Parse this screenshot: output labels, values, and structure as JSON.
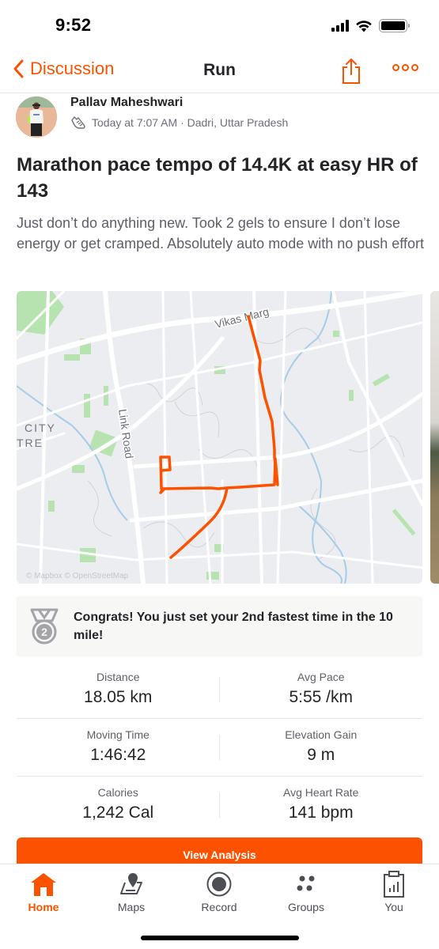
{
  "status_bar": {
    "time": "9:52"
  },
  "nav": {
    "back_label": "Discussion",
    "title": "Run",
    "share_icon": "share-icon",
    "more_icon": "more-horizontal-icon"
  },
  "athlete": {
    "name": "Pallav Maheshwari",
    "activity_icon": "run-shoe-icon",
    "meta": "Today at 7:07 AM · Dadri, Uttar Pradesh"
  },
  "activity": {
    "title": "Marathon pace tempo of 14.4K at easy HR of 143",
    "description": "Just don’t do anything new. Took 2 gels to ensure I don’t lose energy or get cramped. Absolutely auto mode with no push effort"
  },
  "map": {
    "labels": {
      "road_top": "Vikas Marg",
      "road_left": "Link Road",
      "area_line1": "CITY",
      "area_line2": "TRE"
    },
    "route_color": "#fc5200",
    "attribution": "© Mapbox © OpenStreetMap"
  },
  "achievement": {
    "icon": "medal-2nd-icon",
    "rank": "2",
    "text": "Congrats! You just set your 2nd fastest time in the 10 mile!"
  },
  "stats": [
    [
      {
        "label": "Distance",
        "value": "18.05 km"
      },
      {
        "label": "Avg Pace",
        "value": "5:55 /km"
      }
    ],
    [
      {
        "label": "Moving Time",
        "value": "1:46:42"
      },
      {
        "label": "Elevation Gain",
        "value": "9 m"
      }
    ],
    [
      {
        "label": "Calories",
        "value": "1,242 Cal"
      },
      {
        "label": "Avg Heart Rate",
        "value": "141 bpm"
      }
    ]
  ],
  "view_analysis_label": "View Analysis",
  "tabs": [
    {
      "label": "Home",
      "icon": "home-icon",
      "active": true
    },
    {
      "label": "Maps",
      "icon": "map-pin-icon",
      "active": false
    },
    {
      "label": "Record",
      "icon": "record-icon",
      "active": false
    },
    {
      "label": "Groups",
      "icon": "groups-icon",
      "active": false
    },
    {
      "label": "You",
      "icon": "clipboard-chart-icon",
      "active": false
    }
  ],
  "colors": {
    "brand": "#fc5200",
    "text_primary": "#242428",
    "text_secondary": "#5e5e66"
  }
}
